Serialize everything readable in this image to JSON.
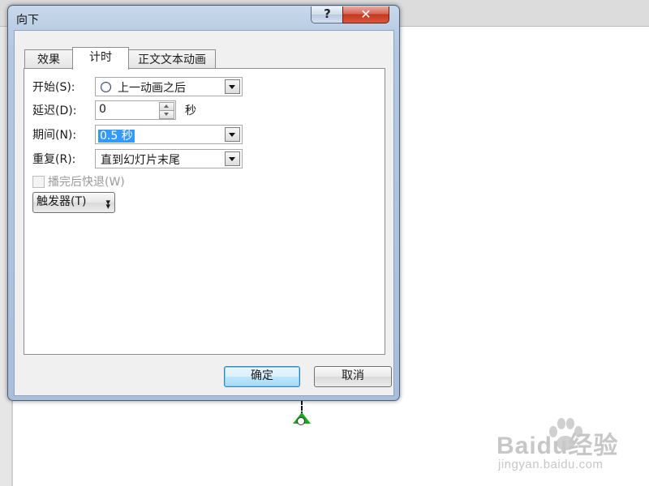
{
  "dialog": {
    "title": "向下",
    "help_label": "?",
    "close_label": "✕"
  },
  "tabs": [
    {
      "label": "效果"
    },
    {
      "label": "计时"
    },
    {
      "label": "正文文本动画"
    }
  ],
  "timing": {
    "start_label": "开始(S):",
    "start_value": "上一动画之后",
    "delay_label": "延迟(D):",
    "delay_value": "0",
    "delay_unit": "秒",
    "duration_label": "期间(N):",
    "duration_value": "0.5 秒",
    "repeat_label": "重复(R):",
    "repeat_value": "直到幻灯片末尾",
    "rewind_label": "播完后快退(W)",
    "triggers_label": "触发器(T)"
  },
  "buttons": {
    "ok_label": "确定",
    "cancel_label": "取消"
  },
  "watermark": {
    "brand": "Baidu经验",
    "url": "jingyan.baidu.com"
  },
  "colors": {
    "selection": "#3399ff",
    "close_button": "#c2381f",
    "anchor": "#1ba81b"
  }
}
